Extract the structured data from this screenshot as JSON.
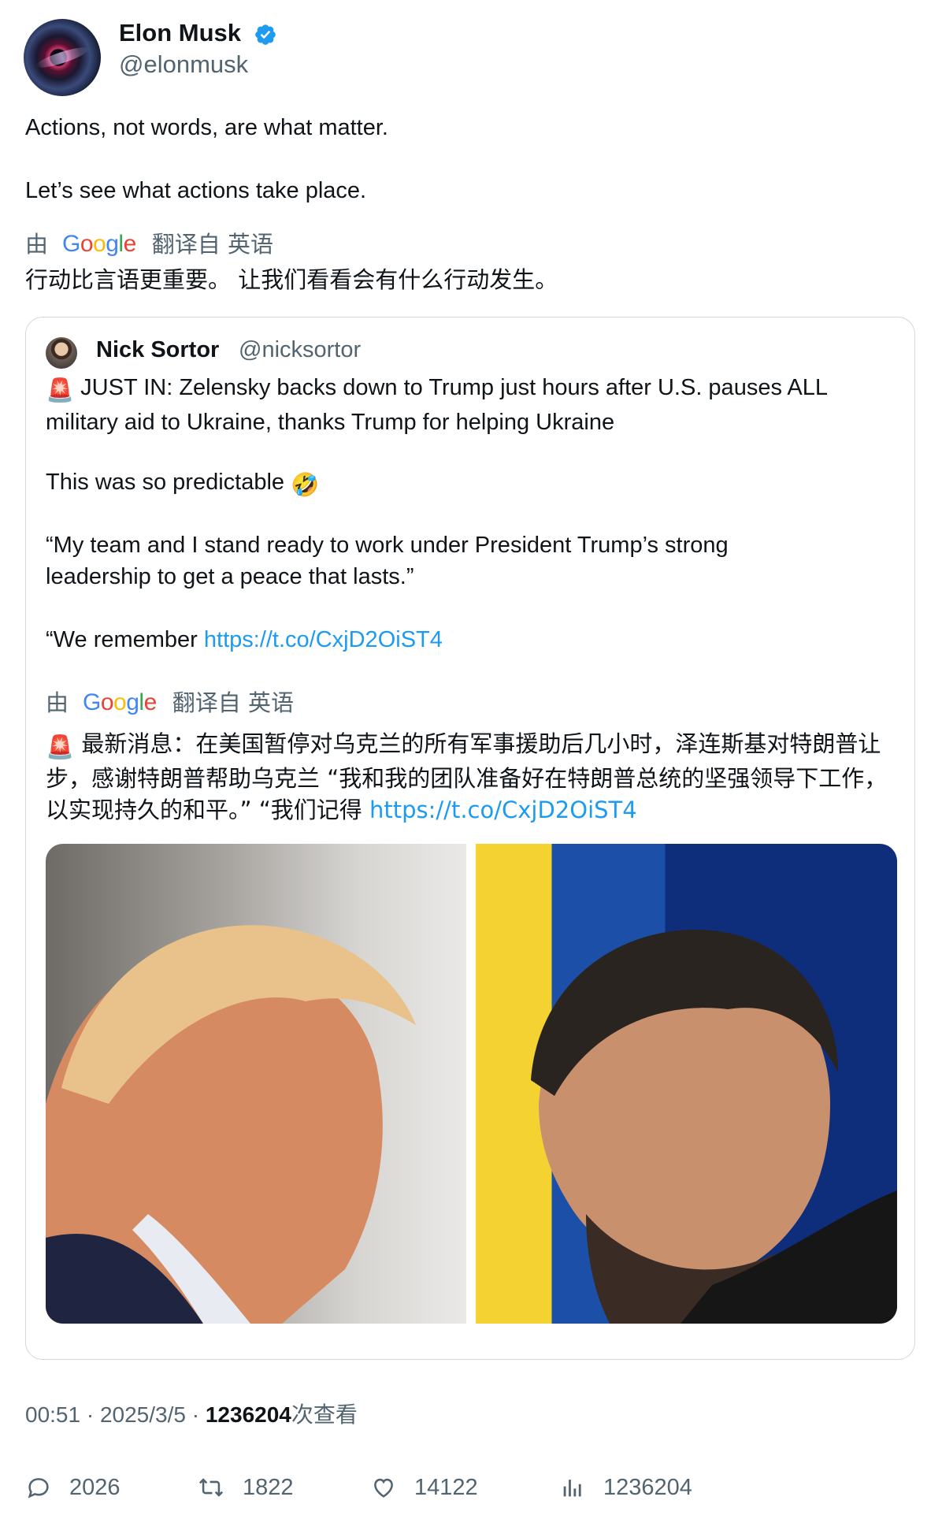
{
  "author": {
    "name": "Elon Musk",
    "handle": "@elonmusk",
    "verified_color": "#1d9bf0"
  },
  "tweet": {
    "line1": "Actions, not words, are what matter.",
    "line2": "Let’s see what actions take place.",
    "translate": {
      "prefix": "由",
      "provider": "Google",
      "suffix": "翻译自 英语",
      "text": "行动比言语更重要。 让我们看看会有什么行动发生。"
    }
  },
  "quoted": {
    "name": "Nick Sortor",
    "handle": "@nicksortor",
    "emoji_siren": "🚨",
    "para1": "JUST IN: Zelensky backs down to Trump just hours after U.S. pauses ALL military aid to Ukraine, thanks Trump for helping Ukraine",
    "para2": "This was so predictable",
    "emoji_laugh": "🤣",
    "para3": "“My team and I stand ready to work under President Trump’s strong leadership to get a peace that lasts.”",
    "para4_prefix": "“We remember ",
    "link": "https://t.co/CxjD2OiST4",
    "translate": {
      "prefix": "由",
      "provider": "Google",
      "suffix": "翻译自 英语",
      "text": "最新消息：在美国暂停对乌克兰的所有军事援助后几小时，泽连斯基对特朗普让步，感谢特朗普帮助乌克兰 “我和我的团队准备好在特朗普总统的坚强领导下工作，以实现持久的和平。” “我们记得 ",
      "link": "https://t.co/CxjD2OiST4"
    }
  },
  "meta": {
    "time": "00:51",
    "date": "2025/3/5",
    "views": "1236204",
    "views_label": "次查看"
  },
  "actions": {
    "replies": "2026",
    "retweets": "1822",
    "likes": "14122",
    "views": "1236204"
  }
}
